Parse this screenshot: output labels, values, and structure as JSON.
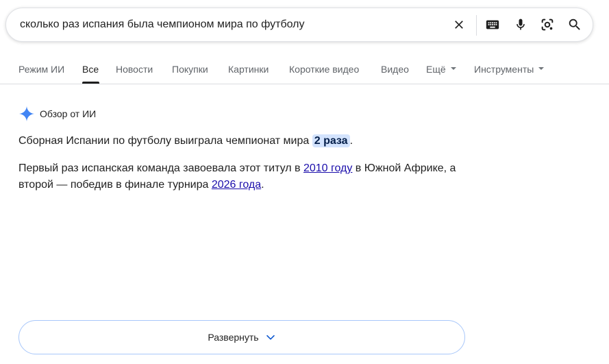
{
  "search": {
    "query": "сколько раз испания была чемпионом мира по футболу"
  },
  "search_icons": [
    "close-icon",
    "keyboard-icon",
    "microphone-icon",
    "lens-icon",
    "search-icon"
  ],
  "tabs": [
    {
      "label": "Режим ИИ"
    },
    {
      "label": "Все",
      "active": true
    },
    {
      "label": "Новости"
    },
    {
      "label": "Покупки"
    },
    {
      "label": "Картинки"
    },
    {
      "label": "Короткие видео"
    },
    {
      "label": "Видео"
    },
    {
      "label": "Ещё"
    },
    {
      "label": "Инструменты"
    }
  ],
  "ai_overview": {
    "title": "Обзор от ИИ",
    "p1_before": "Сборная Испании по футболу выиграла чемпионат мира ",
    "p1_highlight": "2 раза",
    "p1_after": ".",
    "p2_part1": "Первый раз испанская команда завоевала этот титул в ",
    "p2_link1": "2010 году",
    "p2_part2": " в Южной Африке, а",
    "p2_part3": "второй — победив в финале турнира ",
    "p2_link2": "2026 года",
    "p2_part4": "."
  },
  "expand": {
    "label": "Развернуть"
  },
  "colors": {
    "link": "#1a0dab",
    "highlight_bg": "#d3e3fd",
    "expand_border": "#a8c7fa",
    "gemini_spark": "#4285f4"
  }
}
